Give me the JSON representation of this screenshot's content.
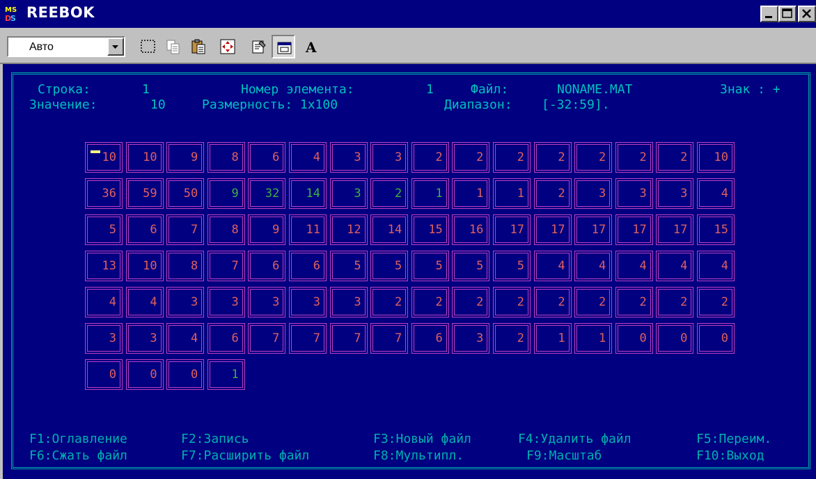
{
  "window": {
    "title": "REEBOK",
    "icon": "ms-dos-icon",
    "controls": [
      "minimize-icon",
      "maximize-icon",
      "close-icon"
    ]
  },
  "toolbar": {
    "font_size_value": "Авто",
    "buttons": [
      "mark-icon",
      "copy-icon",
      "paste-icon",
      "fullscreen-icon",
      "properties-icon",
      "background-icon",
      "font-icon"
    ],
    "font_button_label": "A"
  },
  "header": {
    "row_label": "Строка:",
    "row_value": "1",
    "element_label": "Номер элемента:",
    "element_value": "1",
    "file_label": "Файл:",
    "file_value": "NONAME.MAT",
    "sign_label": "Знак : +",
    "value_label": "Значение:",
    "value_value": "10",
    "dims_label": "Размерность: 1x100",
    "range_label": "Диапазон:",
    "range_value": "[-32:59]."
  },
  "matrix": {
    "rows": [
      [
        "10",
        "10",
        "9",
        "8",
        "6",
        "4",
        "3",
        "3",
        "2",
        "2",
        "2",
        "2",
        "2",
        "2",
        "2",
        "10"
      ],
      [
        "36",
        "59",
        "50",
        "9",
        "32",
        "14",
        "3",
        "2",
        "1",
        "1",
        "1",
        "2",
        "3",
        "3",
        "3",
        "4"
      ],
      [
        "5",
        "6",
        "7",
        "8",
        "9",
        "11",
        "12",
        "14",
        "15",
        "16",
        "17",
        "17",
        "17",
        "17",
        "17",
        "15"
      ],
      [
        "13",
        "10",
        "8",
        "7",
        "6",
        "6",
        "5",
        "5",
        "5",
        "5",
        "5",
        "4",
        "4",
        "4",
        "4",
        "4"
      ],
      [
        "4",
        "4",
        "3",
        "3",
        "3",
        "3",
        "3",
        "2",
        "2",
        "2",
        "2",
        "2",
        "2",
        "2",
        "2",
        "2"
      ],
      [
        "3",
        "3",
        "4",
        "6",
        "7",
        "7",
        "7",
        "7",
        "6",
        "3",
        "2",
        "1",
        "1",
        "0",
        "0",
        "0"
      ],
      [
        "0",
        "0",
        "0",
        "1"
      ]
    ],
    "colors": [
      [
        "#e06060",
        "#e06060",
        "#e06060",
        "#e06060",
        "#e06060",
        "#e06060",
        "#e06060",
        "#e06060",
        "#e06060",
        "#e06060",
        "#e06060",
        "#e06060",
        "#e06060",
        "#e06060",
        "#e06060",
        "#e06060"
      ],
      [
        "#e06060",
        "#e06060",
        "#e06060",
        "#40b040",
        "#40b040",
        "#40b040",
        "#40b040",
        "#40b040",
        "#40b040",
        "#e06060",
        "#e06060",
        "#e06060",
        "#e06060",
        "#e06060",
        "#e06060",
        "#e06060"
      ],
      [
        "#e06060",
        "#e06060",
        "#e06060",
        "#e06060",
        "#e06060",
        "#e06060",
        "#e06060",
        "#e06060",
        "#e06060",
        "#e06060",
        "#e06060",
        "#e06060",
        "#e06060",
        "#e06060",
        "#e06060",
        "#e06060"
      ],
      [
        "#e06060",
        "#e06060",
        "#e06060",
        "#e06060",
        "#e06060",
        "#e06060",
        "#e06060",
        "#e06060",
        "#e06060",
        "#e06060",
        "#e06060",
        "#e06060",
        "#e06060",
        "#e06060",
        "#e06060",
        "#e06060"
      ],
      [
        "#e06060",
        "#e06060",
        "#e06060",
        "#e06060",
        "#e06060",
        "#e06060",
        "#e06060",
        "#e06060",
        "#e06060",
        "#e06060",
        "#e06060",
        "#e06060",
        "#e06060",
        "#e06060",
        "#e06060",
        "#e06060"
      ],
      [
        "#e06060",
        "#e06060",
        "#e06060",
        "#e06060",
        "#e06060",
        "#e06060",
        "#e06060",
        "#e06060",
        "#e06060",
        "#e06060",
        "#e06060",
        "#e06060",
        "#e06060",
        "#e06060",
        "#e06060",
        "#e06060"
      ],
      [
        "#e06060",
        "#e06060",
        "#e06060",
        "#40b040"
      ]
    ]
  },
  "function_keys": {
    "f1": "F1:Оглавление",
    "f2": "F2:Запись",
    "f3": "F3:Новый файл",
    "f4": "F4:Удалить файл",
    "f5": "F5:Переим.",
    "f6": "F6:Сжать файл",
    "f7": "F7:Расширить файл",
    "f8": "F8:Мультипл.",
    "f9": "F9:Масштаб",
    "f10": "F10:Выход"
  },
  "colors": {
    "console_bg": "#000080",
    "text": "#00c0c0",
    "cell_border": "#c040c0",
    "value_red": "#e06060",
    "value_green": "#40b040"
  }
}
